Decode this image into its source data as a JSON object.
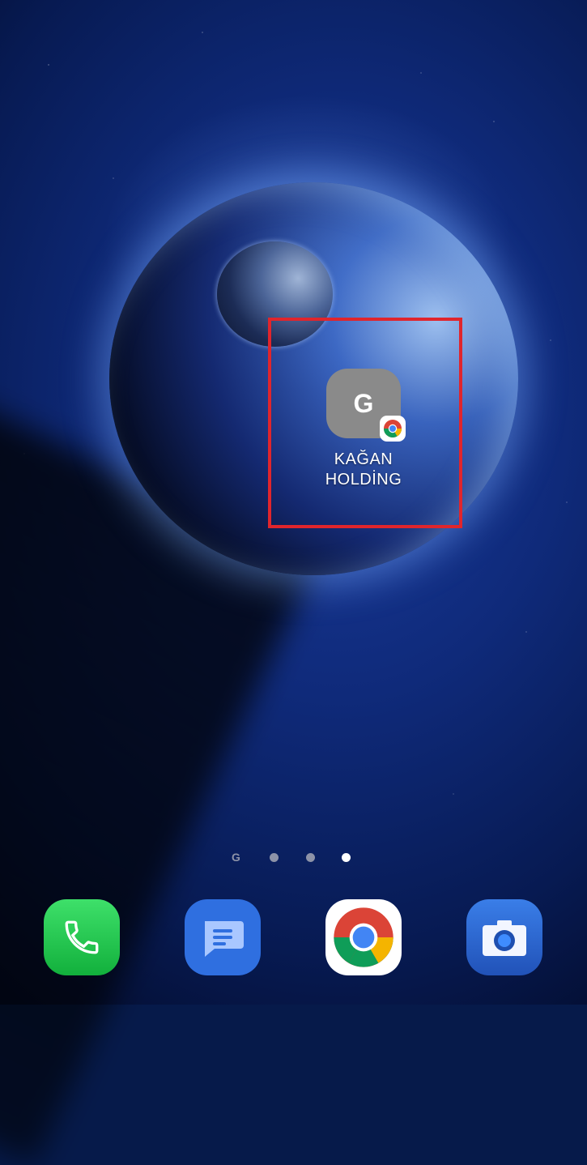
{
  "shortcut": {
    "letter": "G",
    "label_line1": "KAĞAN",
    "label_line2": "HOLDİNG",
    "badge_icon": "chrome-icon",
    "icon_bg_color": "#8a8a8a"
  },
  "highlight": {
    "color": "#e0252c"
  },
  "page_indicator": {
    "google_glyph": "G",
    "pages": 3,
    "active_page": 3
  },
  "dock": {
    "apps": [
      {
        "name": "phone",
        "icon": "phone-icon",
        "color": "#1ec14a"
      },
      {
        "name": "messages",
        "icon": "message-icon",
        "color": "#2f6fe0"
      },
      {
        "name": "chrome",
        "icon": "chrome-icon",
        "color": "#ffffff"
      },
      {
        "name": "camera",
        "icon": "camera-icon",
        "color": "#2b62c8"
      }
    ]
  }
}
